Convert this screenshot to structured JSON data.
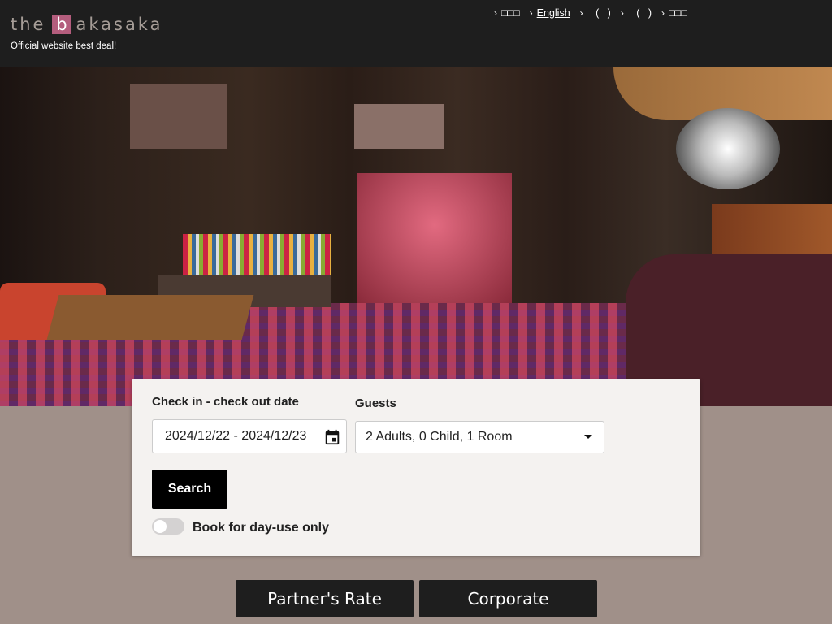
{
  "header": {
    "logo": {
      "pre": "the",
      "mark": "b",
      "post": "akasaka"
    },
    "tagline": "Official website best deal!",
    "nav": [
      {
        "label": "□□□"
      },
      {
        "label": "English",
        "active": true
      },
      {
        "label": "   (   )"
      },
      {
        "label": "   (   )"
      },
      {
        "label": "□□□"
      }
    ],
    "menu_icon": "hamburger-icon"
  },
  "hero": {
    "image": "hotel-lobby-photo"
  },
  "booking": {
    "date_label": "Check in - check out date",
    "date_value": "2024/12/22 - 2024/12/23",
    "guests_label": "Guests",
    "guests_value": "2 Adults, 0 Child, 1 Room",
    "search_label": "Search",
    "dayuse_label": "Book for day-use only",
    "dayuse_on": false
  },
  "buttons": {
    "partner": "Partner's Rate",
    "corporate": "Corporate"
  },
  "colors": {
    "header": "#1e1e1e",
    "brand": "#b45d7d",
    "background": "#a09089"
  }
}
